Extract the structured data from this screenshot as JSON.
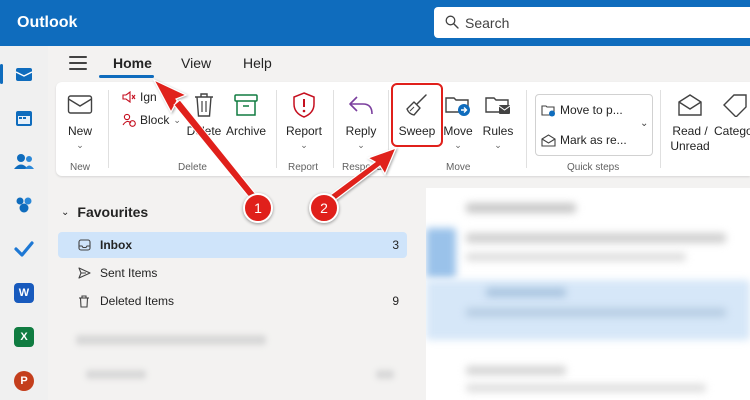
{
  "app": {
    "title": "Outlook"
  },
  "search": {
    "label": "Search"
  },
  "tabs": [
    {
      "label": "Home",
      "active": true
    },
    {
      "label": "View"
    },
    {
      "label": "Help"
    }
  ],
  "ribbon": {
    "new": {
      "label": "New",
      "group": "New"
    },
    "ignore": {
      "label": "Ign"
    },
    "block": {
      "label": "Block"
    },
    "delete": {
      "label": "Delete"
    },
    "archive": {
      "label": "Archive"
    },
    "delete_group": "Delete",
    "report": {
      "label": "Report",
      "group": "Report"
    },
    "reply": {
      "label": "Reply",
      "group": "Respond"
    },
    "sweep": {
      "label": "Sweep"
    },
    "move": {
      "label": "Move"
    },
    "rules": {
      "label": "Rules"
    },
    "move_group": "Move",
    "quick_steps": {
      "item1": "Move to p...",
      "item2": "Mark as re...",
      "group": "Quick steps"
    },
    "read_unread": {
      "line1": "Read /",
      "line2": "Unread"
    },
    "categorize": {
      "label": "Catego"
    }
  },
  "folders": {
    "favourites_label": "Favourites",
    "items": [
      {
        "label": "Inbox",
        "count": "3",
        "selected": true
      },
      {
        "label": "Sent Items",
        "count": ""
      },
      {
        "label": "Deleted Items",
        "count": "9"
      }
    ]
  },
  "annotations": {
    "badge1": "1",
    "badge2": "2"
  },
  "colors": {
    "brand": "#0f6cbd",
    "annotation": "#e0201b",
    "selected": "#cfe4fa"
  }
}
